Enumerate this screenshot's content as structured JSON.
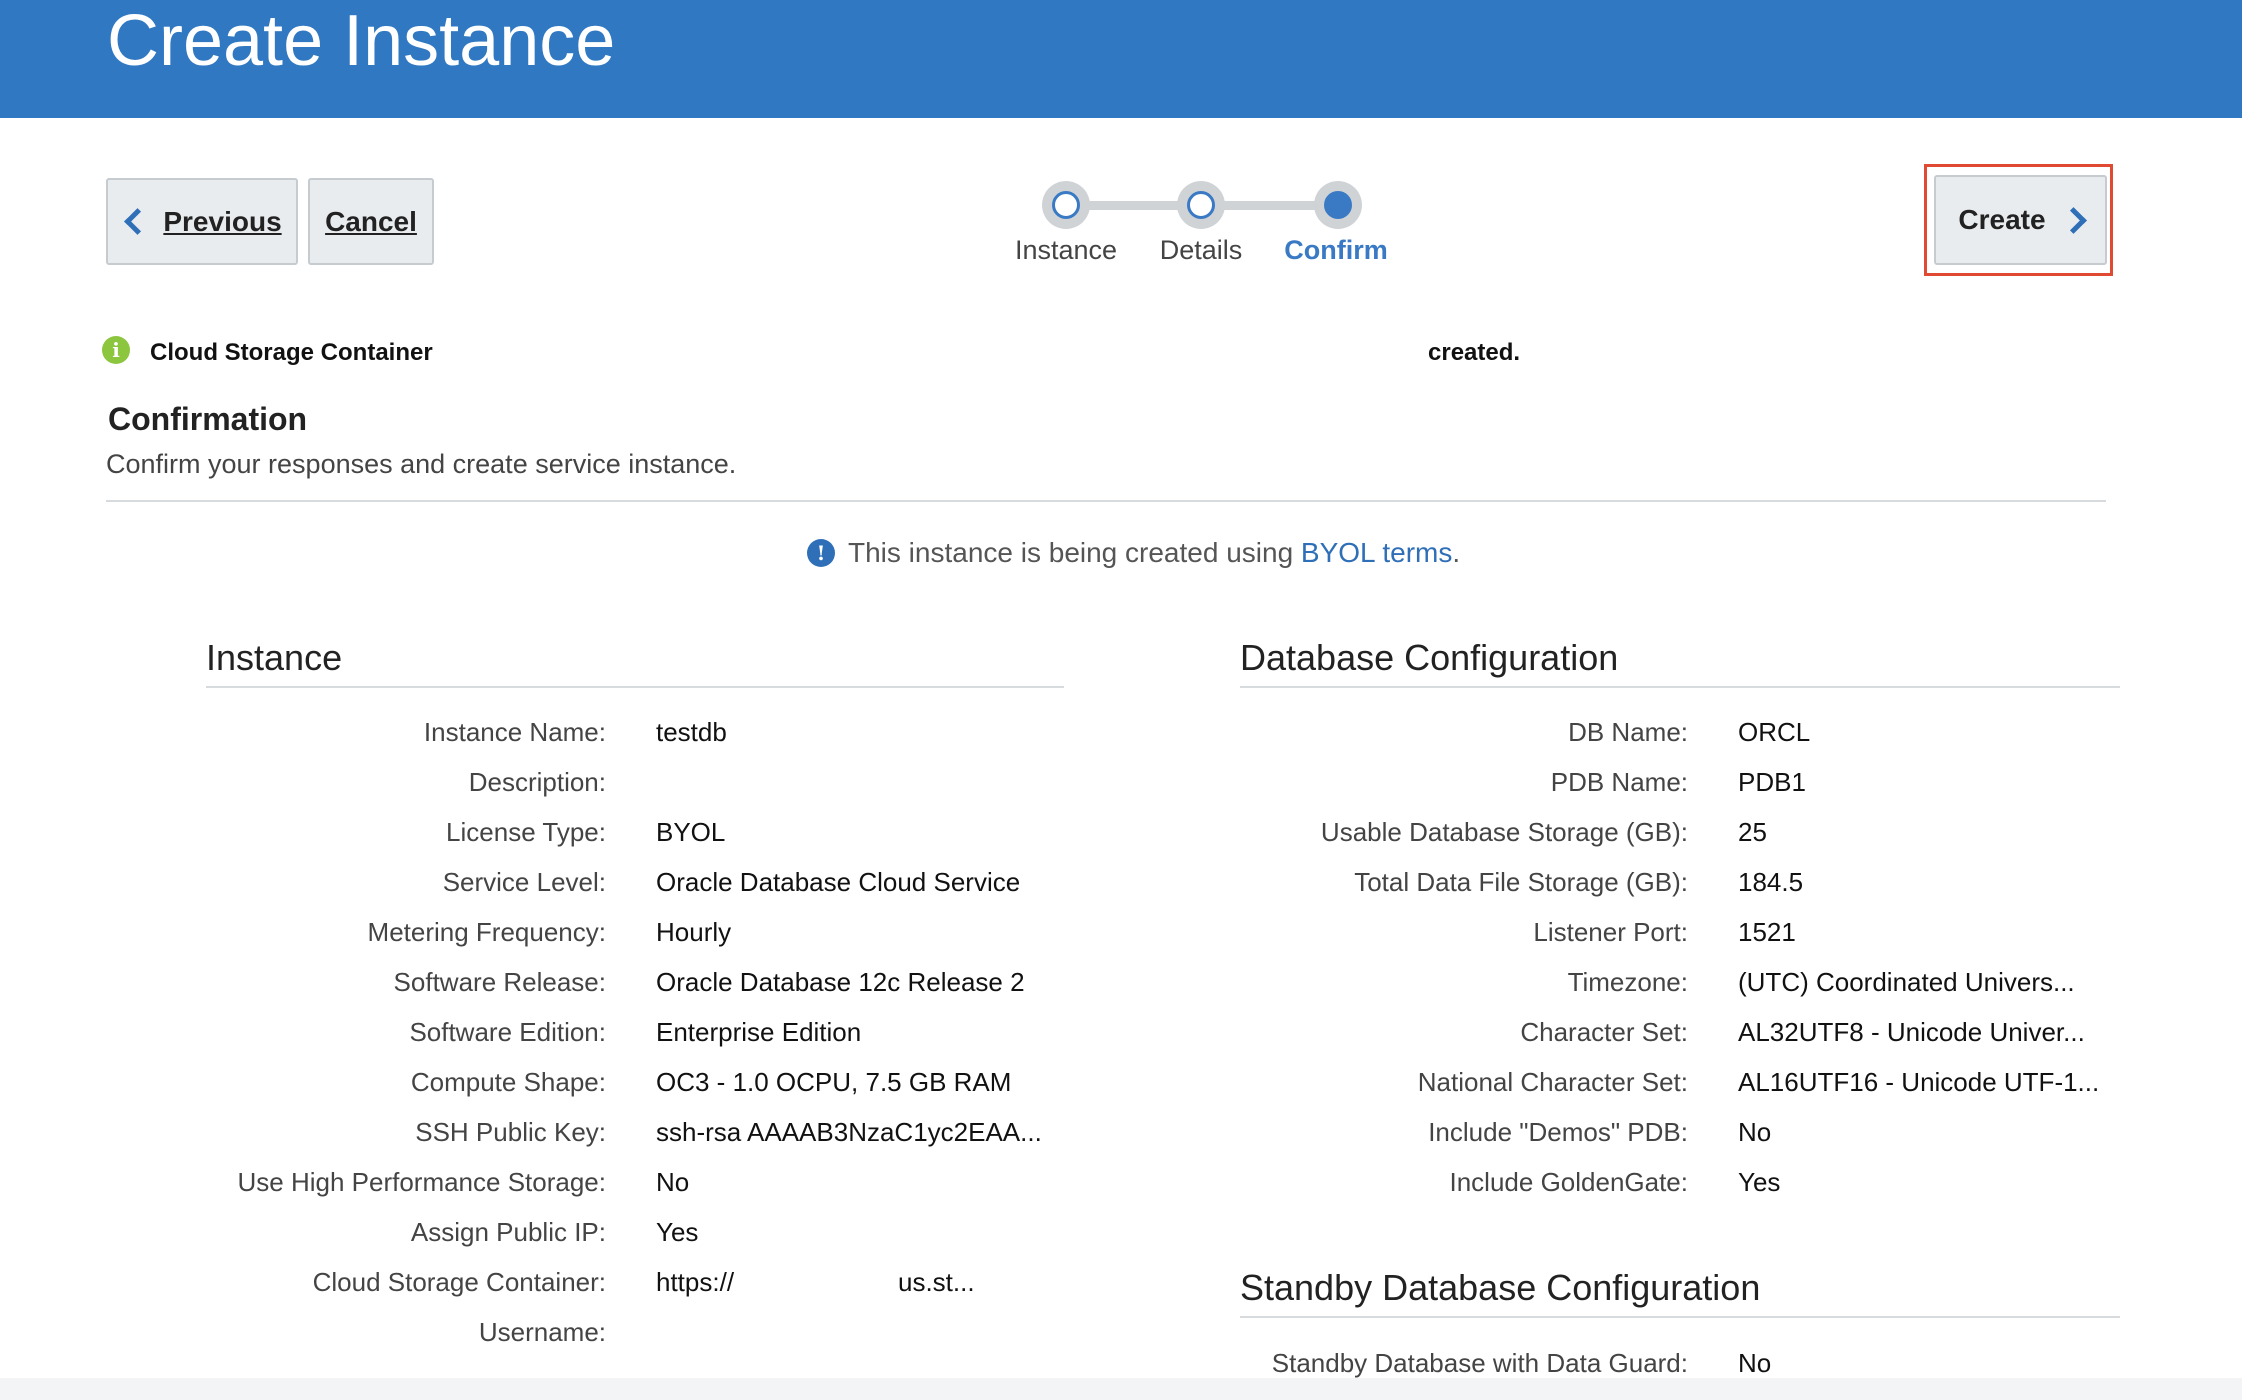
{
  "page": {
    "title": "Create Instance"
  },
  "toolbar": {
    "previous_label": "Previous",
    "cancel_label": "Cancel",
    "create_label": "Create"
  },
  "train": {
    "steps": [
      {
        "label": "Instance",
        "state": "completed"
      },
      {
        "label": "Details",
        "state": "completed"
      },
      {
        "label": "Confirm",
        "state": "current"
      }
    ]
  },
  "notice": {
    "prefix": "Cloud Storage Container",
    "suffix": "created."
  },
  "confirmation": {
    "title": "Confirmation",
    "subtitle": "Confirm your responses and create service instance."
  },
  "byol": {
    "text": "This instance is being created using ",
    "link": "BYOL terms",
    "end": "."
  },
  "instance": {
    "title": "Instance",
    "rows": [
      {
        "label": "Instance Name:",
        "value": "testdb"
      },
      {
        "label": "Description:",
        "value": ""
      },
      {
        "label": "License Type:",
        "value": "BYOL"
      },
      {
        "label": "Service Level:",
        "value": "Oracle Database Cloud Service"
      },
      {
        "label": "Metering Frequency:",
        "value": "Hourly"
      },
      {
        "label": "Software Release:",
        "value": "Oracle Database 12c Release 2"
      },
      {
        "label": "Software Edition:",
        "value": "Enterprise Edition"
      },
      {
        "label": "Compute Shape:",
        "value": "OC3 - 1.0 OCPU, 7.5 GB RAM"
      },
      {
        "label": "SSH Public Key:",
        "value": "ssh-rsa AAAAB3NzaC1yc2EAA..."
      },
      {
        "label": "Use High Performance Storage:",
        "value": "No"
      },
      {
        "label": "Assign Public IP:",
        "value": "Yes"
      },
      {
        "label": "Cloud Storage Container:",
        "value": "https://",
        "value_end": "us.st..."
      },
      {
        "label": "Username:",
        "value": ""
      }
    ]
  },
  "database": {
    "title": "Database Configuration",
    "rows": [
      {
        "label": "DB Name:",
        "value": "ORCL"
      },
      {
        "label": "PDB Name:",
        "value": "PDB1"
      },
      {
        "label": "Usable Database Storage (GB):",
        "value": "25"
      },
      {
        "label": "Total Data File Storage (GB):",
        "value": "184.5"
      },
      {
        "label": "Listener Port:",
        "value": "1521"
      },
      {
        "label": "Timezone:",
        "value": "(UTC) Coordinated Univers..."
      },
      {
        "label": "Character Set:",
        "value": "AL32UTF8 - Unicode Univer..."
      },
      {
        "label": "National Character Set:",
        "value": "AL16UTF16 - Unicode UTF-1..."
      },
      {
        "label": "Include \"Demos\" PDB:",
        "value": "No"
      },
      {
        "label": "Include GoldenGate:",
        "value": "Yes"
      }
    ]
  },
  "standby": {
    "title": "Standby Database Configuration",
    "rows": [
      {
        "label": "Standby Database with Data Guard:",
        "value": "No"
      }
    ]
  },
  "colors": {
    "banner": "#3079c2",
    "link": "#2f6fb8",
    "create_highlight": "#e04a33",
    "notice_icon": "#8cc63f"
  },
  "icons": {
    "previous": "chevron-left-icon",
    "create": "chevron-right-icon",
    "notice": "info-icon",
    "byol": "info-icon"
  }
}
